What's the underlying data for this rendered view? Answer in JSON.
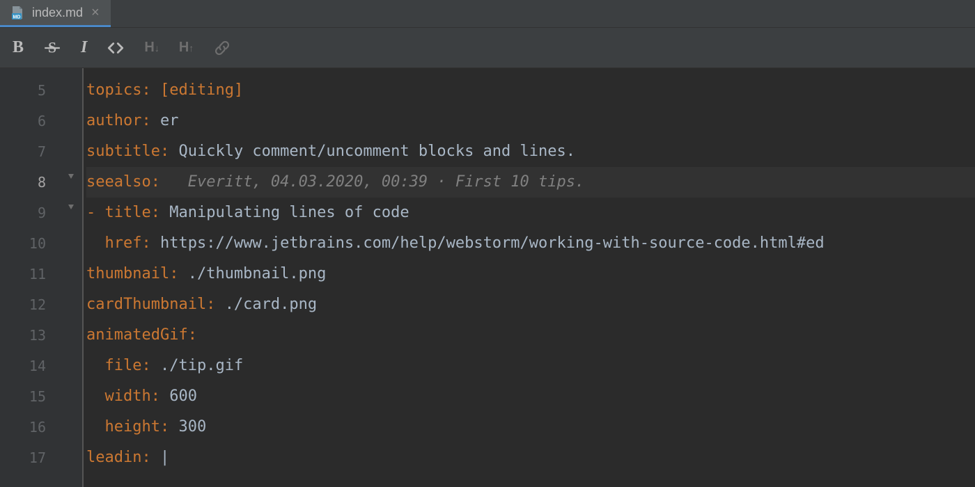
{
  "tab": {
    "filename": "index.md"
  },
  "toolbar": {
    "bold": "B",
    "strikethrough": "S",
    "italic": "I",
    "code": "<>",
    "header_down": "H↓",
    "header_up": "H↑"
  },
  "editor": {
    "lines": [
      {
        "number": "5",
        "key": "topics:",
        "bracket_open": "[",
        "value": "editing",
        "bracket_close": "]"
      },
      {
        "number": "6",
        "key": "author:",
        "value": "er"
      },
      {
        "number": "7",
        "key": "subtitle:",
        "value": "Quickly comment/uncomment blocks and lines."
      },
      {
        "number": "8",
        "key": "seealso:",
        "annotation": "Everitt, 04.03.2020, 00:39 · First 10 tips.",
        "highlighted": true
      },
      {
        "number": "9",
        "dash": "- ",
        "key": "title:",
        "value": "Manipulating lines of code"
      },
      {
        "number": "10",
        "indent": "  ",
        "key": "href:",
        "value": "https://www.jetbrains.com/help/webstorm/working-with-source-code.html#ed"
      },
      {
        "number": "11",
        "key": "thumbnail:",
        "value": "./thumbnail.png"
      },
      {
        "number": "12",
        "key": "cardThumbnail:",
        "value": "./card.png"
      },
      {
        "number": "13",
        "key": "animatedGif:"
      },
      {
        "number": "14",
        "indent": "  ",
        "key": "file:",
        "value": "./tip.gif"
      },
      {
        "number": "15",
        "indent": "  ",
        "key": "width:",
        "value": "600"
      },
      {
        "number": "16",
        "indent": "  ",
        "key": "height:",
        "value": "300"
      },
      {
        "number": "17",
        "key": "leadin:",
        "value": "|"
      }
    ]
  }
}
